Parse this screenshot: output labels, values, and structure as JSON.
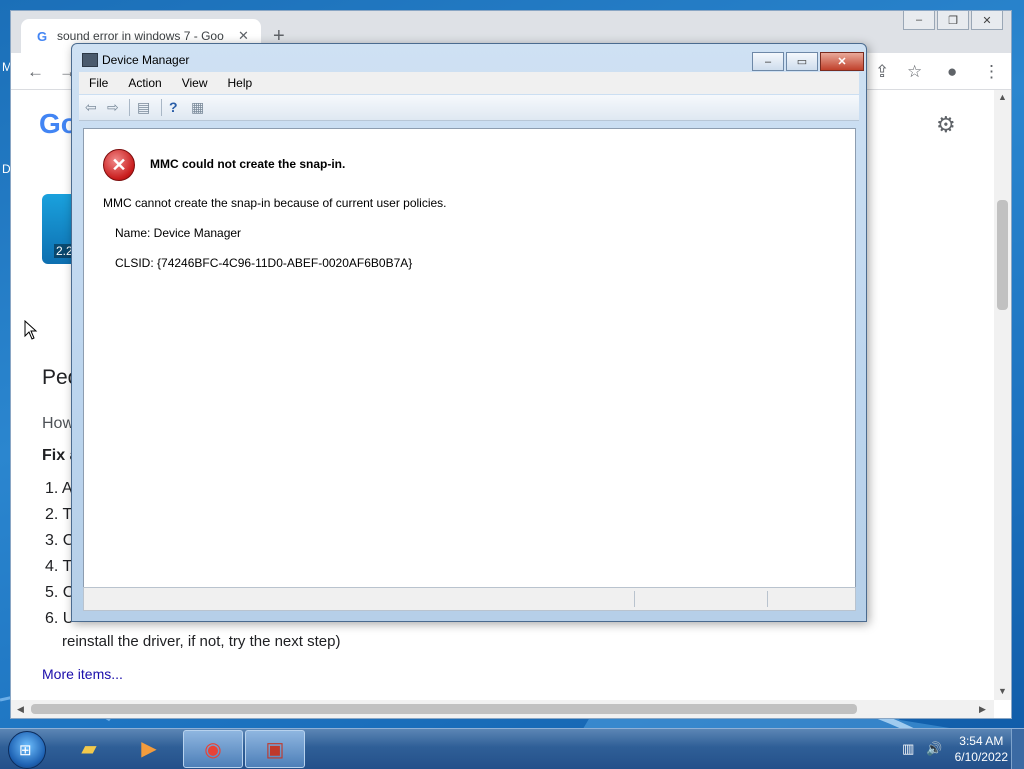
{
  "desktop": {
    "edge_letters": [
      "M",
      "D"
    ]
  },
  "chrome": {
    "tab_title": "sound error in windows 7 - Goo",
    "tab_favicon": "G",
    "new_tab": "+",
    "page": {
      "logo": "Go",
      "thumb_duration": "2.2",
      "heading": "Peo",
      "subtext": "How",
      "fix_label": "Fix a",
      "steps": [
        "1. A",
        "2. T",
        "3. C",
        "4. T",
        "5. C",
        "6. U"
      ],
      "step6_cont": "reinstall the driver, if not, try the next step)",
      "more_items": "More items..."
    }
  },
  "device_manager": {
    "title": "Device Manager",
    "menu": [
      "File",
      "Action",
      "View",
      "Help"
    ],
    "error": {
      "title": "MMC could not create the snap-in.",
      "body": "MMC cannot create the snap-in because of current user policies.",
      "name": "Name: Device Manager",
      "clsid": "CLSID: {74246BFC-4C96-11D0-ABEF-0020AF6B0B7A}"
    }
  },
  "taskbar": {
    "time": "3:54 AM",
    "date": "6/10/2022",
    "apps": [
      "explorer",
      "media-player",
      "chrome",
      "toolbox"
    ]
  },
  "colors": {
    "accent": "#1d73c0",
    "error_red": "#c81b1b",
    "link": "#1a0dab"
  }
}
